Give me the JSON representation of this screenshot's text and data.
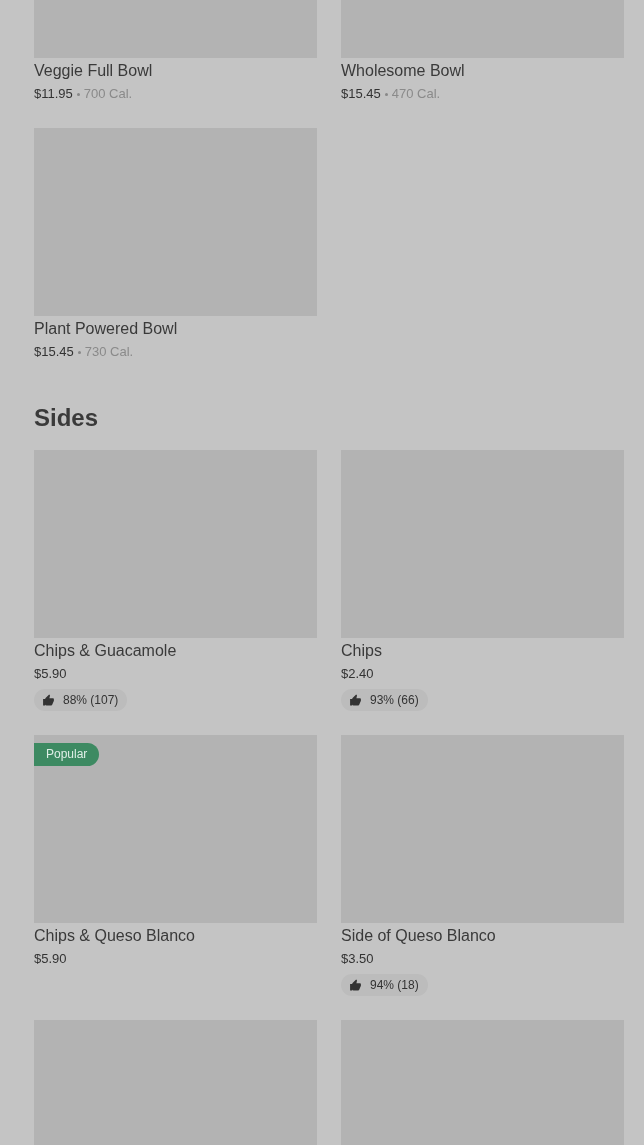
{
  "sections": [
    {
      "items": [
        {
          "kind": "item",
          "name": "Veggie Full Bowl",
          "price": "$11.95",
          "calories": "700 Cal."
        },
        {
          "kind": "item",
          "name": "Wholesome Bowl",
          "price": "$15.45",
          "calories": "470 Cal."
        },
        {
          "kind": "item",
          "name": "Plant Powered Bowl",
          "price": "$15.45",
          "calories": "730 Cal."
        }
      ]
    },
    {
      "heading": "Sides",
      "items": [
        {
          "kind": "item",
          "name": "Chips & Guacamole",
          "price": "$5.90",
          "rating": "88% (107)"
        },
        {
          "kind": "item",
          "name": "Chips",
          "price": "$2.40",
          "rating": "93% (66)"
        },
        {
          "kind": "item",
          "name": "Chips & Queso Blanco",
          "price": "$5.90",
          "badge": "Popular"
        },
        {
          "kind": "item",
          "name": "Side of Queso Blanco",
          "price": "$3.50",
          "rating": "94% (18)"
        },
        {
          "kind": "image_only"
        },
        {
          "kind": "image_only"
        }
      ]
    }
  ]
}
